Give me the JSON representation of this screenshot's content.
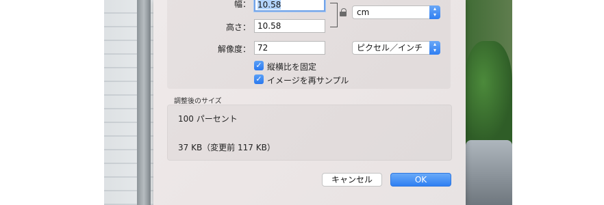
{
  "dialog": {
    "width_label": "幅：",
    "width_value": "10.58",
    "height_label": "高さ：",
    "height_value": "10.58",
    "size_unit": "cm",
    "resolution_label": "解像度：",
    "resolution_value": "72",
    "resolution_unit": "ピクセル／インチ",
    "keep_ratio_label": "縦横比を固定",
    "keep_ratio_checked": true,
    "resample_label": "イメージを再サンプル",
    "resample_checked": true,
    "result_section_title": "調整後のサイズ",
    "result_percent": "100 パーセント",
    "result_filesize": "37 KB（変更前 117 KB）",
    "cancel_label": "キャンセル",
    "ok_label": "OK"
  },
  "icons": {
    "lock": "lock-icon",
    "popup_arrows": "updown-chevron-icon",
    "checkmark": "checkmark-icon"
  },
  "colors": {
    "accent": "#2f7ff2",
    "dialog_bg": "#ece6e6"
  }
}
